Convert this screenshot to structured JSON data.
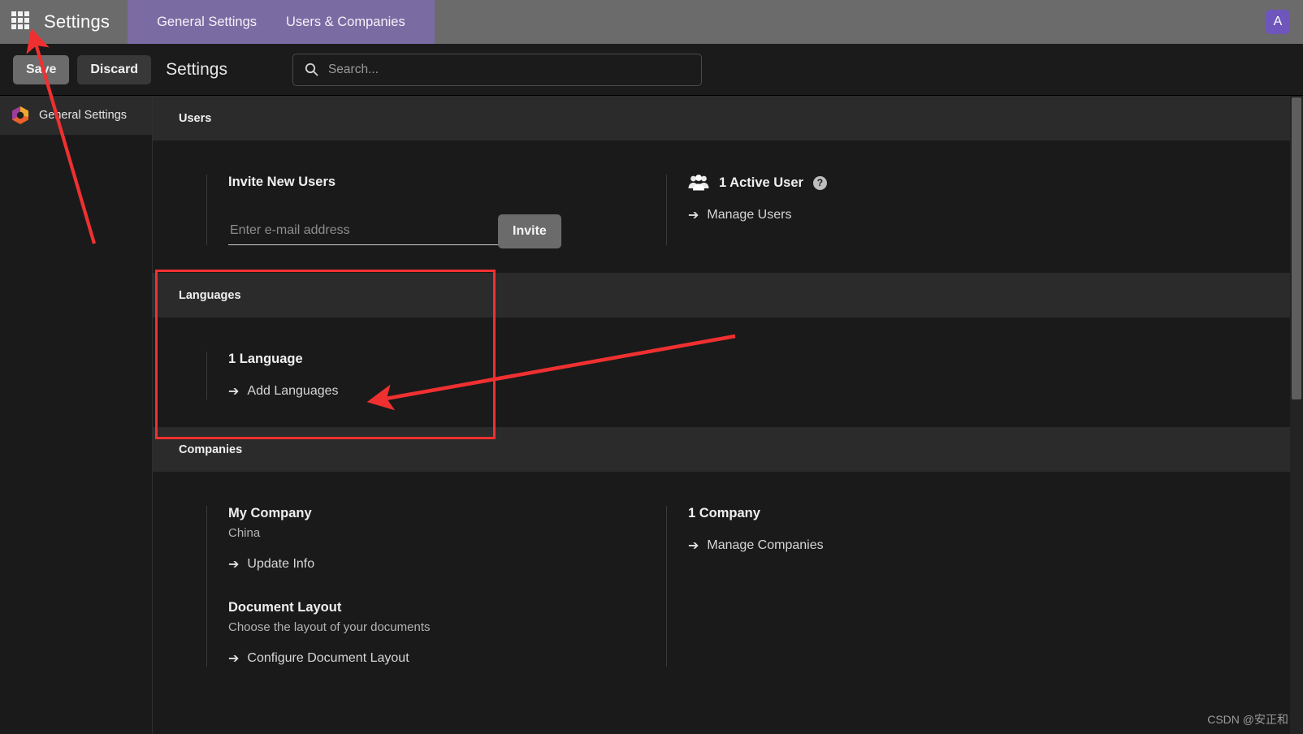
{
  "navbar": {
    "apps_icon": "grid-apps-icon",
    "brand_title": "Settings",
    "tabs": [
      {
        "label": "General Settings"
      },
      {
        "label": "Users & Companies"
      }
    ],
    "avatar_initial": "A",
    "avatar_color": "#6f56bd",
    "tabs_background": "#7b6ba3"
  },
  "control_panel": {
    "save_label": "Save",
    "discard_label": "Discard",
    "title": "Settings",
    "search_placeholder": "Search...",
    "search_value": "",
    "search_icon": "search-icon"
  },
  "sidebar": {
    "items": [
      {
        "label": "General Settings",
        "icon": "odoo-hexagon-logo"
      }
    ]
  },
  "sections": {
    "users": {
      "header": "Users",
      "invite": {
        "title": "Invite New Users",
        "email_placeholder": "Enter e-mail address",
        "email_value": "",
        "invite_button": "Invite"
      },
      "active": {
        "icon": "users-group-icon",
        "count_text": "1 Active User",
        "help_icon": "question-mark-icon",
        "link": "Manage Users"
      }
    },
    "languages": {
      "header": "Languages",
      "count_text": "1 Language",
      "link": "Add Languages"
    },
    "companies": {
      "header": "Companies",
      "my_company": {
        "title": "My Company",
        "subtitle": "China",
        "link": "Update Info"
      },
      "document_layout": {
        "title": "Document Layout",
        "subtitle": "Choose the layout of your documents",
        "link": "Configure Document Layout"
      },
      "count": {
        "count_text": "1 Company",
        "link": "Manage Companies"
      }
    }
  },
  "annotations": {
    "highlight_color": "#f03030",
    "box_label": "languages-section-highlight",
    "arrow_to_apps_label": "arrow-pointing-to-apps-icon",
    "arrow_to_add_languages_label": "arrow-pointing-to-add-languages"
  },
  "watermark": "CSDN @安正和",
  "arrow_glyph": "➔"
}
